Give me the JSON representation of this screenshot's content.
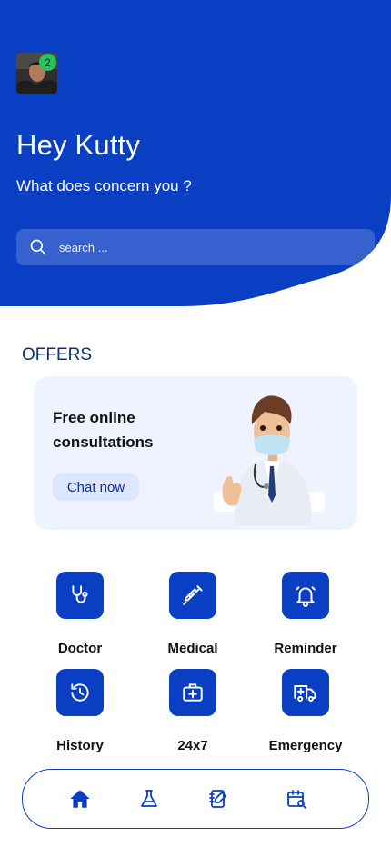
{
  "colors": {
    "primary": "#0a3fc4",
    "accent_badge": "#22c55e",
    "card_bg": "#eef3ff"
  },
  "header": {
    "notification_count": "2",
    "greeting": "Hey Kutty",
    "subtitle": "What does concern you ?",
    "search_placeholder": "search ...",
    "search_icon": "search-icon"
  },
  "offers": {
    "title": "OFFERS",
    "card": {
      "text": "Free online consultations",
      "button": "Chat now"
    }
  },
  "services": [
    {
      "label": "Doctor",
      "icon": "stethoscope-icon"
    },
    {
      "label": "Medical",
      "icon": "syringe-icon"
    },
    {
      "label": "Reminder",
      "icon": "bell-icon"
    },
    {
      "label": "History",
      "icon": "history-icon"
    },
    {
      "label": "24x7",
      "icon": "first-aid-kit-icon"
    },
    {
      "label": "Emergency",
      "icon": "ambulance-icon"
    }
  ],
  "bottom_nav": [
    {
      "name": "home",
      "icon": "home-icon",
      "active": true
    },
    {
      "name": "lab",
      "icon": "flask-icon",
      "active": false
    },
    {
      "name": "notes",
      "icon": "notebook-edit-icon",
      "active": false
    },
    {
      "name": "appointments",
      "icon": "calendar-search-icon",
      "active": false
    }
  ]
}
